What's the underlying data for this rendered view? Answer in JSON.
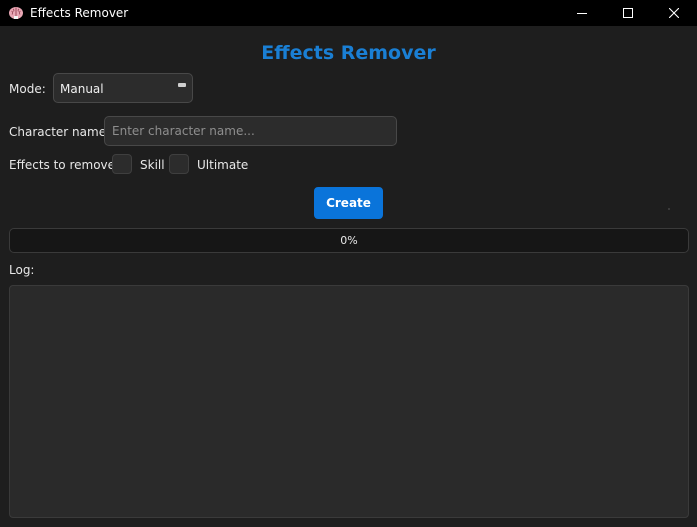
{
  "window": {
    "title": "Effects Remover"
  },
  "header": {
    "title": "Effects Remover"
  },
  "mode": {
    "label": "Mode:",
    "selected": "Manual"
  },
  "character": {
    "label": "Character name:",
    "value": "",
    "placeholder": "Enter character name..."
  },
  "effects": {
    "label": "Effects to remove:",
    "options": [
      {
        "label": "Skill",
        "checked": false
      },
      {
        "label": "Ultimate",
        "checked": false
      }
    ]
  },
  "actions": {
    "create_label": "Create"
  },
  "progress": {
    "value": 0,
    "text": "0%"
  },
  "log": {
    "label": "Log:",
    "content": ""
  },
  "colors": {
    "accent": "#0a74da",
    "heading": "#1a7fd4",
    "background": "#1e1e1e",
    "titlebar": "#000000"
  },
  "icons": {
    "app": "brain-icon",
    "minimize": "minimize-icon",
    "maximize": "maximize-icon",
    "close": "close-icon",
    "dropdown": "dropdown-arrow-icon"
  }
}
